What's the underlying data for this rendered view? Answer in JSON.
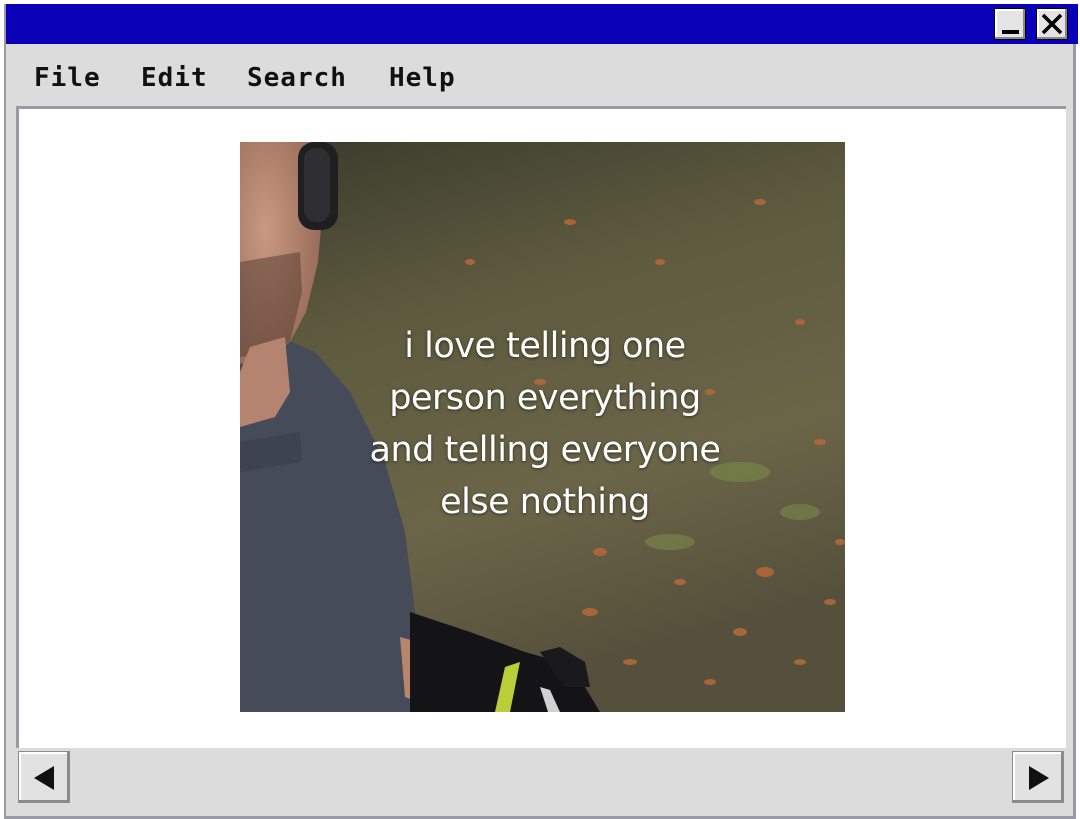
{
  "window": {
    "title": "",
    "minimize_icon": "minimize-icon",
    "close_icon": "close-icon",
    "titlebar_color": "#0a00b8"
  },
  "menu": {
    "items": [
      {
        "label": "File"
      },
      {
        "label": "Edit"
      },
      {
        "label": "Search"
      },
      {
        "label": "Help"
      }
    ]
  },
  "content": {
    "image_caption": [
      "i love telling one",
      "person everything",
      "and telling everyone",
      "else nothing"
    ]
  },
  "scrollbar": {
    "left_icon": "arrow-left-icon",
    "right_icon": "arrow-right-icon"
  }
}
